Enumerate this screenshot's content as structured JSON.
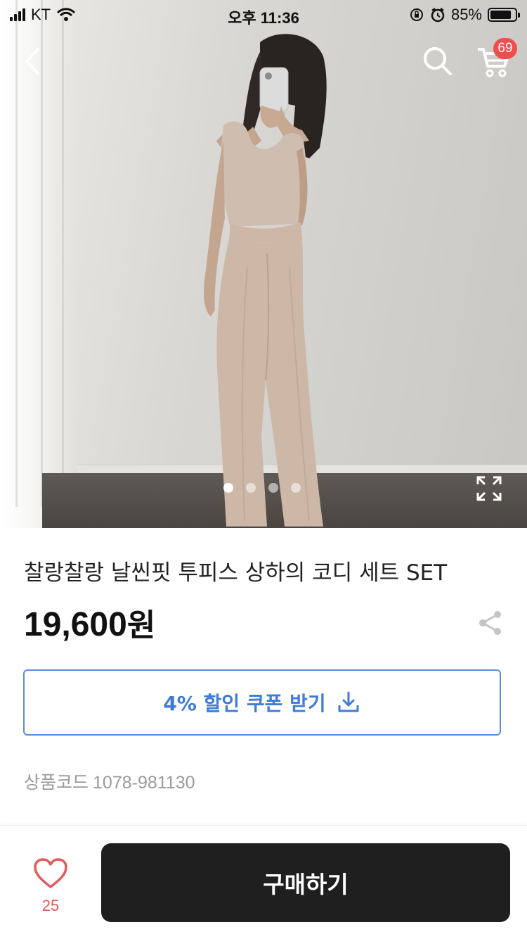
{
  "status_bar": {
    "carrier": "KT",
    "time": "오후 11:36",
    "battery_percent": "85%",
    "battery_level": 0.85
  },
  "header": {
    "back_icon": "chevron-left-icon",
    "search_icon": "search-icon",
    "cart_icon": "cart-icon",
    "cart_count": "69"
  },
  "gallery": {
    "image": "product photo: model in beige sleeveless top and wide pants",
    "page_count": 4,
    "active_index": 0,
    "expand_icon": "expand-icon"
  },
  "product": {
    "title": "찰랑찰랑 날씬핏 투피스 상하의 코디 세트 SET",
    "price": "19,600",
    "currency": "원",
    "share_icon": "share-icon"
  },
  "coupon": {
    "label": "4% 할인 쿠폰 받기",
    "icon": "download-icon",
    "color": "#3f7bd9"
  },
  "product_code": {
    "label": "상품코드",
    "value": "1078-981130"
  },
  "bottom_bar": {
    "like_icon": "heart-icon",
    "like_count": "25",
    "buy_label": "구매하기"
  }
}
